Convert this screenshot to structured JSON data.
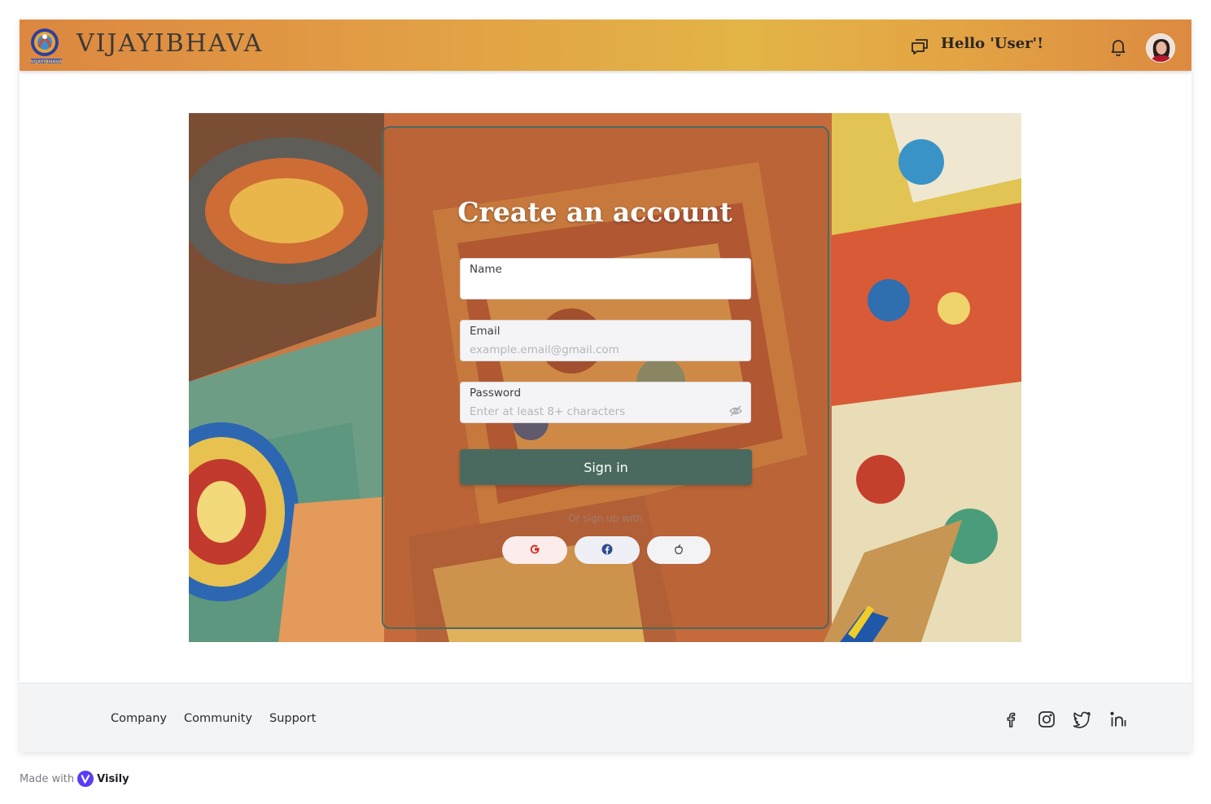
{
  "header": {
    "brand": "VIJAYIBHAVA",
    "logo_text": "VIJAYIBHAVA",
    "greeting": "Hello 'User'!",
    "icons": [
      "chat-icon",
      "bell-icon"
    ],
    "avatar": "avatar"
  },
  "signup": {
    "title": "Create an account",
    "name": {
      "label": "Name",
      "placeholder": ""
    },
    "email": {
      "label": "Email",
      "placeholder": "example.email@gmail.com"
    },
    "password": {
      "label": "Password",
      "placeholder": "Enter at least 8+ characters"
    },
    "submit_label": "Sign in",
    "or_text": "Or sign up with",
    "social": [
      "google-icon",
      "facebook-icon",
      "apple-icon"
    ]
  },
  "footer": {
    "links": [
      "Company",
      "Community",
      "Support"
    ],
    "social": [
      "facebook-icon",
      "instagram-icon",
      "twitter-icon",
      "linkedin-icon"
    ]
  },
  "made_with": {
    "prefix": "Made with",
    "name": "Visily"
  },
  "colors": {
    "header_gradient": [
      "#dc8740",
      "#e3b446",
      "#dc8a40"
    ],
    "primary": "#4a6a60",
    "footer_bg": "#f3f4f6"
  }
}
